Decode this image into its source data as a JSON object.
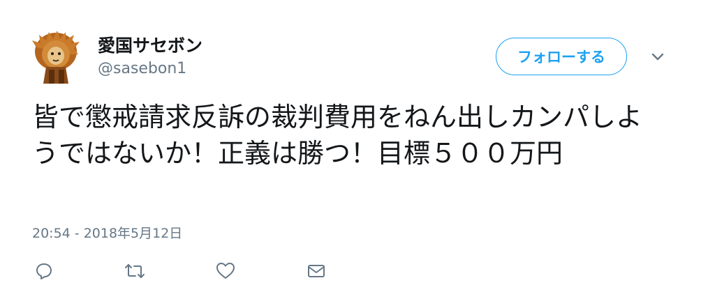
{
  "user": {
    "display_name": "愛国サセボン",
    "handle": "@sasebon1"
  },
  "header": {
    "follow_label": "フォローする",
    "menu_icon": "chevron-down-icon"
  },
  "tweet": {
    "text": "皆で懲戒請求反訴の裁判費用をねん出しカンパしようではないか！正義は勝つ！目標５００万円",
    "timestamp": "20:54 - 2018年5月12日"
  },
  "actions": [
    {
      "name": "reply",
      "icon": "reply-icon"
    },
    {
      "name": "retweet",
      "icon": "retweet-icon"
    },
    {
      "name": "like",
      "icon": "heart-icon"
    },
    {
      "name": "direct-message",
      "icon": "envelope-icon"
    }
  ],
  "colors": {
    "accent": "#1da1f2",
    "text": "#14171a",
    "secondary": "#657786",
    "icon": "#657786"
  }
}
